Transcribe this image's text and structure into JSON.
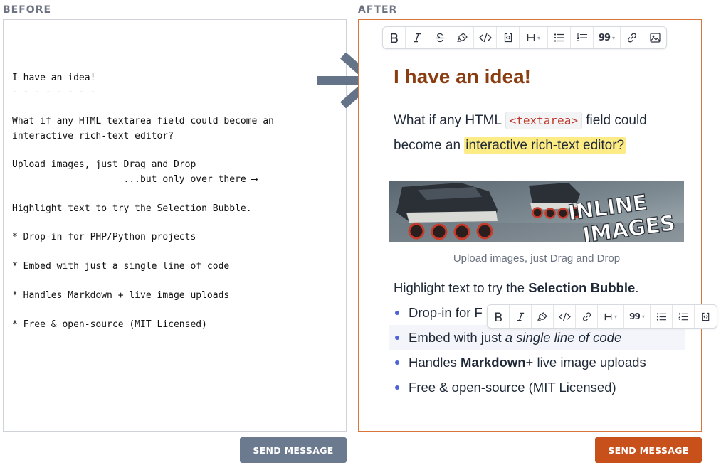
{
  "labels": {
    "before": "BEFORE",
    "after": "AFTER"
  },
  "before": {
    "lines": [
      "I have an idea!",
      "- - - - - - - -",
      "",
      "What if any HTML textarea field could become an",
      "interactive rich-text editor?",
      "",
      "Upload images, just Drag and Drop",
      "                    ...but only over there ⟶",
      "",
      "Highlight text to try the Selection Bubble.",
      "",
      "* Drop-in for PHP/Python projects",
      "",
      "* Embed with just a single line of code",
      "",
      "* Handles Markdown + live image uploads",
      "",
      "* Free & open-source (MIT Licensed)"
    ],
    "send_label": "SEND MESSAGE"
  },
  "after": {
    "title": "I have an idea!",
    "para1": {
      "pre": "What if any HTML ",
      "code": "<textarea>",
      "mid": " field could become an ",
      "highlight": "interactive rich-text editor?"
    },
    "image": {
      "line1": "INLINE",
      "line2": "IMAGES"
    },
    "caption": "Upload images, just Drag and Drop",
    "para2": {
      "pre": "Highlight text to try the ",
      "bold": "Selection Bubble",
      "post": "."
    },
    "bullets": [
      {
        "pre": "Drop-in for F",
        "em": "",
        "post": ""
      },
      {
        "pre": "Embed with just ",
        "em": "a single line of code",
        "post": ""
      },
      {
        "pre": "Handles ",
        "bold": "Markdown",
        "post": " + live image uploads"
      },
      {
        "pre": "Free & open-source (MIT Licensed)",
        "post": ""
      }
    ],
    "send_label": "SEND MESSAGE"
  },
  "toolbar_icons": [
    "bold-icon",
    "italic-icon",
    "strikethrough-icon",
    "highlighter-icon",
    "code-icon",
    "code-block-icon",
    "heading-icon",
    "bullet-list-icon",
    "numbered-list-icon",
    "quote-icon",
    "link-icon",
    "image-icon"
  ],
  "bubble_icons": [
    "bold-icon",
    "italic-icon",
    "highlighter-icon",
    "code-icon",
    "link-icon",
    "heading-icon",
    "quote-icon",
    "bullet-list-icon",
    "numbered-list-icon",
    "code-block-icon"
  ],
  "colors": {
    "title": "#8a3d10",
    "accent": "#c8501b",
    "gray_button": "#6b7a8f",
    "highlight": "#fdeb86",
    "code": "#c0392b",
    "bullet": "#4f63d8"
  }
}
